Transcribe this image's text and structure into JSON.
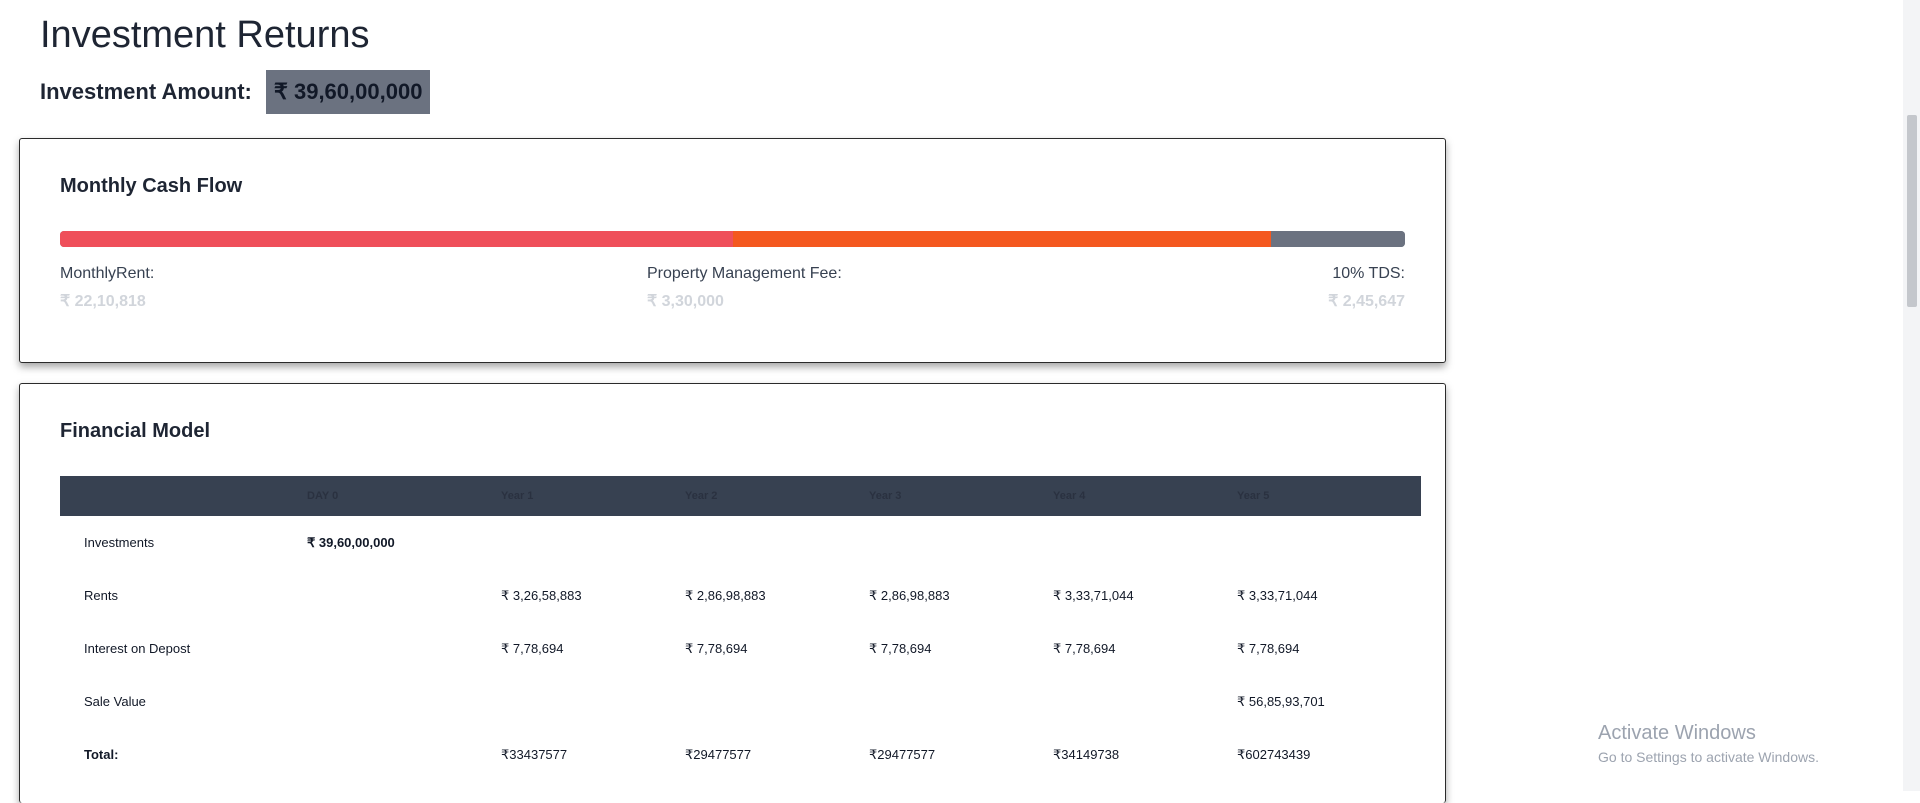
{
  "page": {
    "title": "Investment Returns",
    "amount_label": "Investment Amount:",
    "amount_value": "₹ 39,60,00,000"
  },
  "cashflow": {
    "title": "Monthly Cash Flow",
    "segments": [
      {
        "name": "MonthlyRent:",
        "value": "₹ 22,10,818",
        "amount": 2210818,
        "color": "#ef4f5a"
      },
      {
        "name": "Property Management Fee:",
        "value": "₹ 3,30,000",
        "amount": 330000,
        "color": "#f4581f"
      },
      {
        "name": "10% TDS:",
        "value": "₹ 2,45,647",
        "amount": 245647,
        "color": "#6b7280"
      }
    ],
    "bar_fill_fractions": [
      0.5,
      0.4,
      0.1
    ]
  },
  "model": {
    "title": "Financial Model",
    "headers": [
      "",
      "DAY 0",
      "Year 1",
      "Year 2",
      "Year 3",
      "Year 4",
      "Year 5"
    ],
    "rows": [
      {
        "label": "Investments",
        "cells": [
          "₹ 39,60,00,000",
          "",
          "",
          "",
          "",
          ""
        ]
      },
      {
        "label": "Rents",
        "cells": [
          "",
          "₹ 3,26,58,883",
          "₹ 2,86,98,883",
          "₹ 2,86,98,883",
          "₹ 3,33,71,044",
          "₹ 3,33,71,044"
        ]
      },
      {
        "label": "Interest on Depost",
        "cells": [
          "",
          "₹ 7,78,694",
          "₹ 7,78,694",
          "₹ 7,78,694",
          "₹ 7,78,694",
          "₹ 7,78,694"
        ]
      },
      {
        "label": "Sale Value",
        "cells": [
          "",
          "",
          "",
          "",
          "",
          "₹ 56,85,93,701"
        ]
      },
      {
        "label": "Total:",
        "cells": [
          "",
          "₹33437577",
          "₹29477577",
          "₹29477577",
          "₹34149738",
          "₹602743439"
        ]
      }
    ]
  },
  "watermark": {
    "title": "Activate Windows",
    "subtitle": "Go to Settings to activate Windows."
  },
  "colors": {
    "header_bg": "#374151",
    "amount_bg": "#6b7280",
    "rent": "#ef4f5a",
    "fee": "#f4581f",
    "tds": "#6b7280"
  }
}
